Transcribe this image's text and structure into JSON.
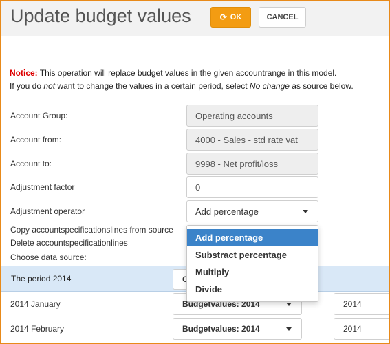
{
  "header": {
    "title": "Update budget values",
    "ok_label": "OK",
    "cancel_label": "CANCEL"
  },
  "notice": {
    "label": "Notice:",
    "line1": " This operation will replace budget values in the given accountrange in this model.",
    "line2_a": "If you do ",
    "line2_not": "not",
    "line2_b": " want to change the values in a certain period, select ",
    "line2_nochange": "No change",
    "line2_c": " as source below."
  },
  "form": {
    "account_group_label": "Account Group:",
    "account_group_value": "Operating accounts",
    "account_from_label": "Account from:",
    "account_from_value": "4000 - Sales - std rate vat",
    "account_to_label": "Account to:",
    "account_to_value": "9998 - Net profit/loss",
    "adjustment_factor_label": "Adjustment factor",
    "adjustment_factor_value": "0",
    "adjustment_operator_label": "Adjustment operator",
    "adjustment_operator_value": "Add percentage",
    "copy_lines_label": "Copy accountspecificationslines from source",
    "delete_lines_label": "Delete accountspecificationlines",
    "choose_source_label": "Choose data source:"
  },
  "dropdown": {
    "options": [
      "Add percentage",
      "Substract percentage",
      "Multiply",
      "Divide"
    ],
    "selected_index": 0
  },
  "periods": {
    "period_label": "The period 2014",
    "period_select_value": "C",
    "rows": [
      {
        "label": "2014 January",
        "source": "Budgetvalues: 2014",
        "year": "2014"
      },
      {
        "label": "2014 February",
        "source": "Budgetvalues: 2014",
        "year": "2014"
      }
    ]
  },
  "colors": {
    "accent": "#f39c12",
    "selected": "#3b83c9",
    "period_row_bg": "#d9e8f7",
    "notice_label": "#dd0000"
  }
}
